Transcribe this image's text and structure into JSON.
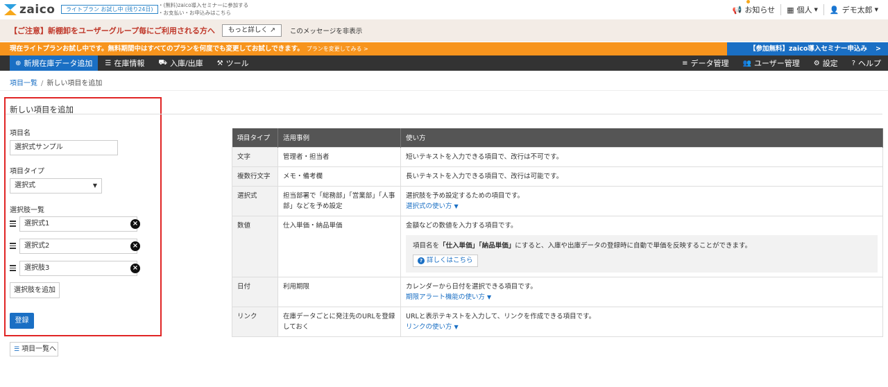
{
  "header": {
    "logo_text": "zaico",
    "trial_badge": "ライトプラン お試し中 (残り24日)",
    "seminar_link": "(無料)zaico導入セミナーに参加する",
    "payment_link": "お支払い・お申込みはこちら",
    "notifications_label": "お知らせ",
    "account_type_label": "個人",
    "user_name": "デモ太郎"
  },
  "caution_bar": {
    "text": "【ご注意】新棚卸をユーザーグループ毎にご利用される方へ",
    "more_button": "もっと詳しく",
    "hide_message": "このメッセージを非表示"
  },
  "trial_bar": {
    "text": "現在ライトプランお試し中です。無料期間中はすべてのプランを何度でも変更してお試しできます。",
    "change_link": "プランを変更してみる >",
    "seminar_button": "【参加無料】zaico導入セミナー申込み",
    "seminar_arrow": ">"
  },
  "nav": {
    "new_item": "新規在庫データ追加",
    "inventory": "在庫情報",
    "in_out": "入庫/出庫",
    "tools": "ツール",
    "data_management": "データ管理",
    "user_management": "ユーザー管理",
    "settings": "設定",
    "help": "ヘルプ"
  },
  "breadcrumb": {
    "parent": "項目一覧",
    "separator": "/",
    "current": "新しい項目を追加"
  },
  "form": {
    "title": "新しい項目を追加",
    "name_label": "項目名",
    "name_value": "選択式サンプル",
    "type_label": "項目タイプ",
    "type_value": "選択式",
    "choices_label": "選択肢一覧",
    "choices": [
      "選択式1",
      "選択式2",
      "選択肢3"
    ],
    "add_choice_button": "選択肢を追加",
    "register_button": "登録",
    "back_button": "項目一覧へ"
  },
  "types_table": {
    "headers": [
      "項目タイプ",
      "活用事例",
      "使い方"
    ],
    "rows": [
      {
        "type": "文字",
        "example": "管理者・担当者",
        "usage": "短いテキストを入力できる項目で、改行は不可です。"
      },
      {
        "type": "複数行文字",
        "example": "メモ・備考欄",
        "usage": "長いテキストを入力できる項目で、改行は可能です。"
      },
      {
        "type": "選択式",
        "example": "担当部署で「総務部」「営業部」「人事部」などを予め設定",
        "usage": "選択肢を予め設定するための項目です。",
        "link": "選択式の使い方"
      },
      {
        "type": "数値",
        "example": "仕入単価・納品単価",
        "usage": "金額などの数値を入力する項目です。",
        "note_prefix": "項目名を",
        "note_bold1": "「仕入単価」",
        "note_bold2": "「納品単価」",
        "note_suffix": "にすると、入庫や出庫データの登録時に自動で単価を反映することができます。",
        "detail_button": "詳しくはこちら"
      },
      {
        "type": "日付",
        "example": "利用期限",
        "usage": "カレンダーから日付を選択できる項目です。",
        "link": "期限アラート機能の使い方"
      },
      {
        "type": "リンク",
        "example": "在庫データごとに発注先のURLを登録しておく",
        "usage": "URLと表示テキストを入力して、リンクを作成できる項目です。",
        "link": "リンクの使い方"
      }
    ]
  },
  "colors": {
    "primary": "#1a6fc4",
    "orange": "#f7941d",
    "caution_red": "#c0392b",
    "highlight_red": "#e02424"
  }
}
